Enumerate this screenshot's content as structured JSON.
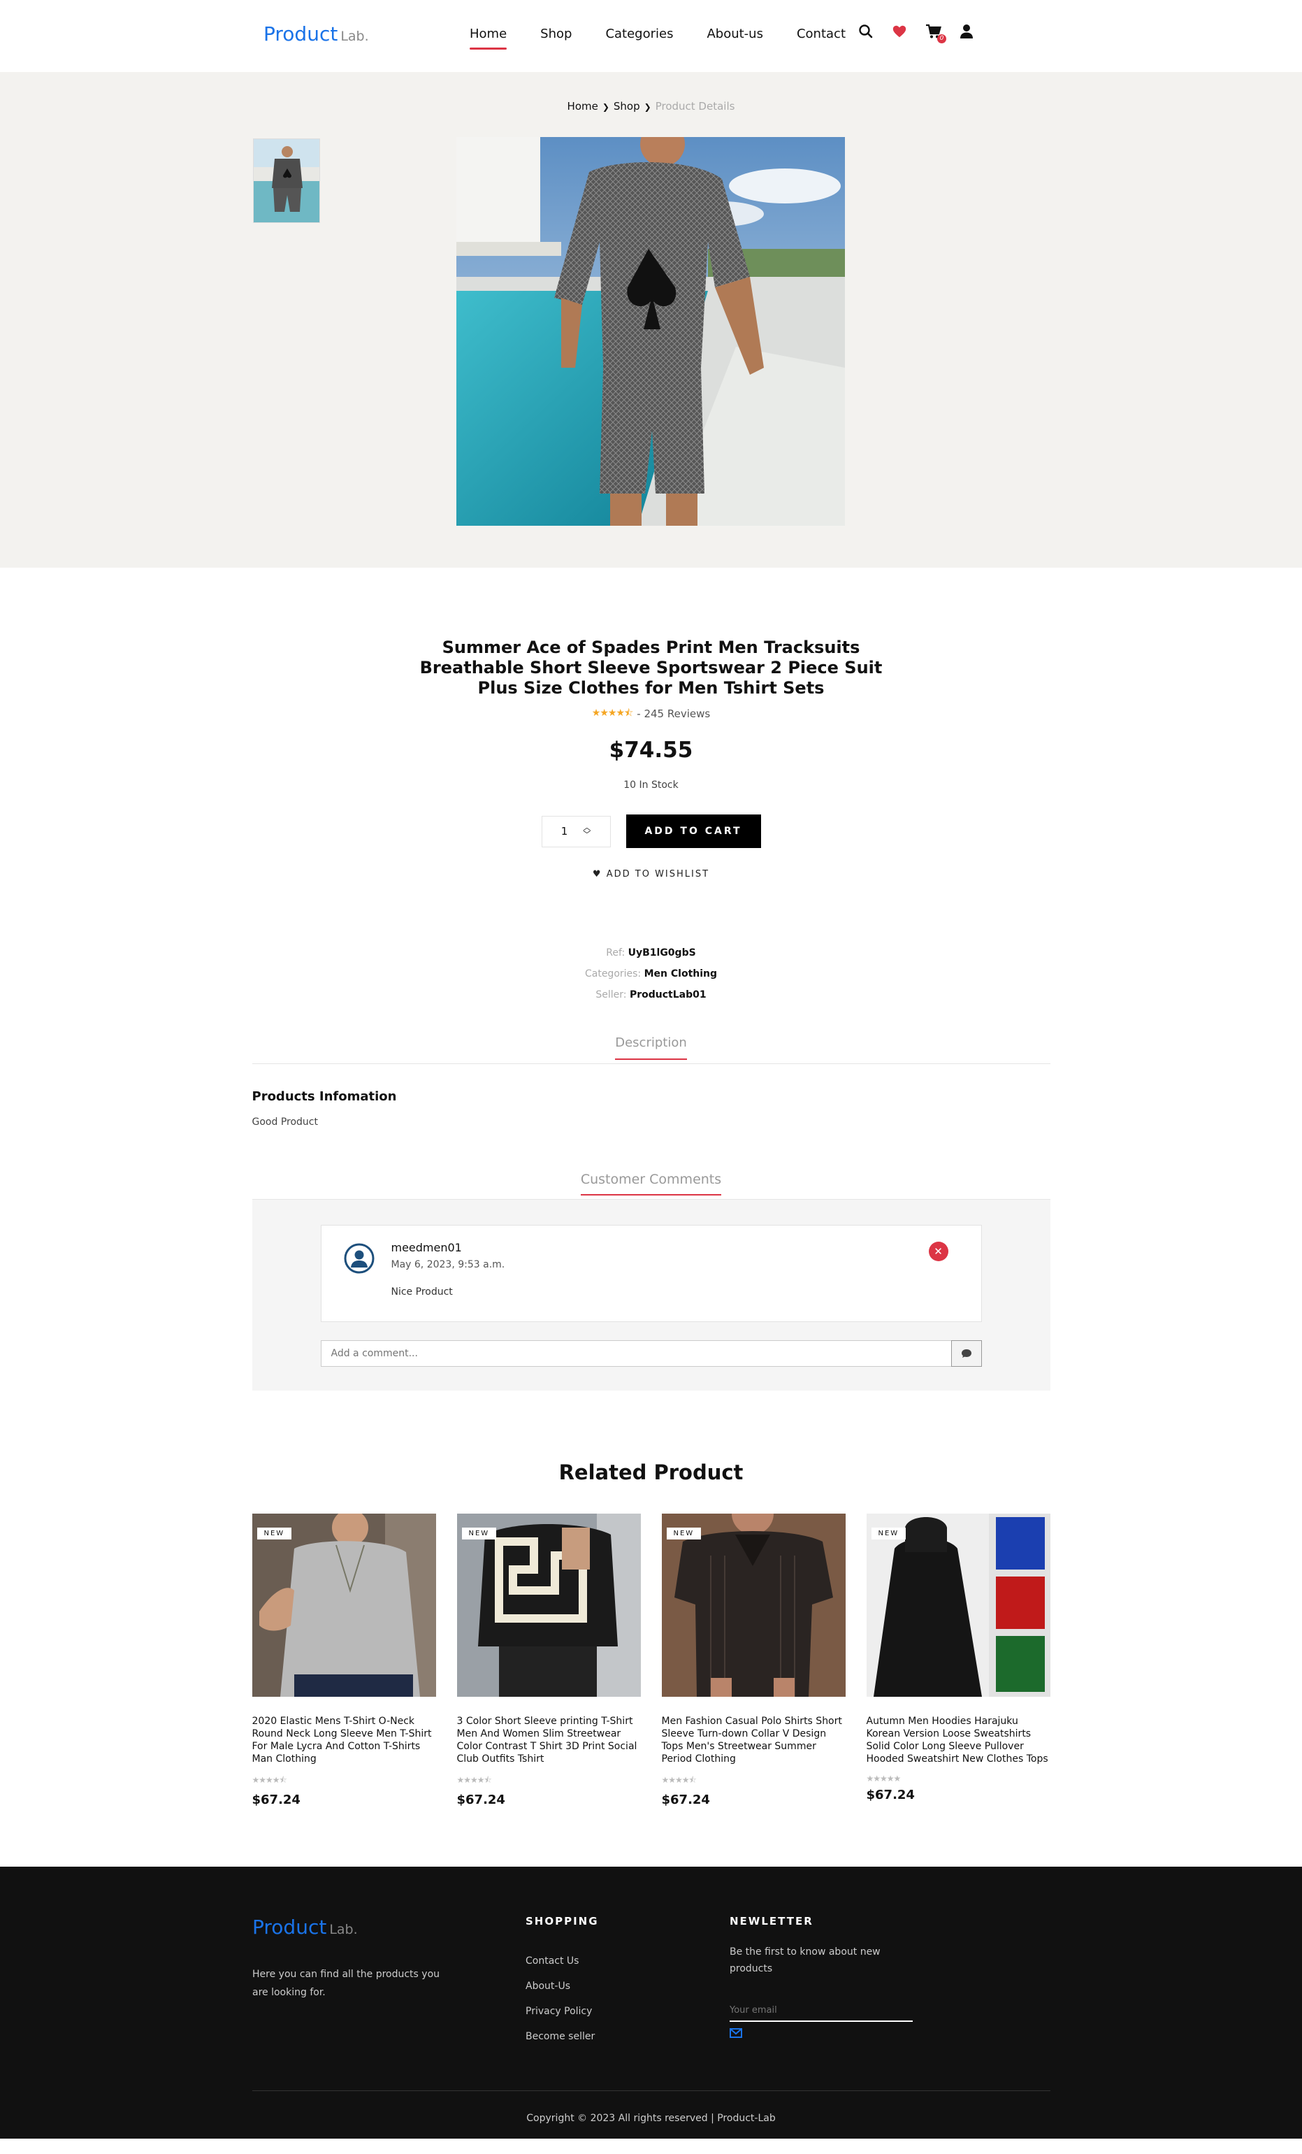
{
  "header": {
    "logo_main": "Product",
    "logo_sub": "Lab.",
    "nav": [
      {
        "label": "Home"
      },
      {
        "label": "Shop"
      },
      {
        "label": "Categories"
      },
      {
        "label": "About-us"
      },
      {
        "label": "Contact"
      }
    ],
    "cart_count": "0",
    "icons": [
      "search-icon",
      "heart-icon",
      "cart-icon",
      "user-icon"
    ],
    "accent_color": "#dc3545",
    "brand_color": "#1a73e8"
  },
  "breadcrumb": {
    "home": "Home",
    "shop": "Shop",
    "current": "Product Details"
  },
  "product": {
    "title": "Summer Ace of Spades Print Men Tracksuits Breathable Short Sleeve Sportswear 2 Piece Suit Plus Size Clothes for Men Tshirt Sets",
    "rating": 4.5,
    "reviews": "- 245 Reviews",
    "price": "$74.55",
    "stock": "10 In Stock",
    "quantity": "1",
    "add_to_cart": "ADD TO CART",
    "add_to_wishlist": "ADD TO WISHLIST",
    "meta": {
      "ref_label": "Ref:",
      "ref_value": "UyB1lG0gbS",
      "categories_label": "Categories:",
      "categories_value": "Men Clothing",
      "seller_label": "Seller:",
      "seller_value": "ProductLab01"
    }
  },
  "description": {
    "tab": "Description",
    "heading": "Products Infomation",
    "text": "Good Product"
  },
  "comments": {
    "tab": "Customer Comments",
    "items": [
      {
        "user": "meedmen01",
        "date": "May 6, 2023, 9:53 a.m.",
        "text": "Nice Product"
      }
    ],
    "input_placeholder": "Add a comment..."
  },
  "related": {
    "title": "Related Product",
    "products": [
      {
        "badge": "NEW",
        "name": "2020 Elastic Mens T-Shirt O-Neck Round Neck Long Sleeve Men T-Shirt For Male Lycra And Cotton T-Shirts Man Clothing",
        "price": "$67.24"
      },
      {
        "badge": "NEW",
        "name": "3 Color Short Sleeve printing T-Shirt Men And Women Slim Streetwear Color Contrast T Shirt 3D Print Social Club Outfits Tshirt",
        "price": "$67.24"
      },
      {
        "badge": "NEW",
        "name": "Men Fashion Casual Polo Shirts Short Sleeve Turn-down Collar V Design Tops Men's Streetwear Summer Period Clothing",
        "price": "$67.24"
      },
      {
        "badge": "NEW",
        "name": "Autumn Men Hoodies Harajuku Korean Version Loose Sweatshirts Solid Color Long Sleeve Pullover Hooded Sweatshirt New Clothes Tops",
        "price": "$67.24"
      }
    ]
  },
  "footer": {
    "logo_main": "Product",
    "logo_sub": "Lab.",
    "about": "Here you can find all the products you are looking for.",
    "shopping_title": "SHOPPING",
    "links": [
      "Contact Us",
      "About-Us",
      "Privacy Policy",
      "Become seller"
    ],
    "newsletter_title": "NEWLETTER",
    "newsletter_text": "Be the first to know about new products",
    "email_placeholder": "Your email",
    "copyright": "Copyright © 2023 All rights reserved | Product-Lab"
  }
}
